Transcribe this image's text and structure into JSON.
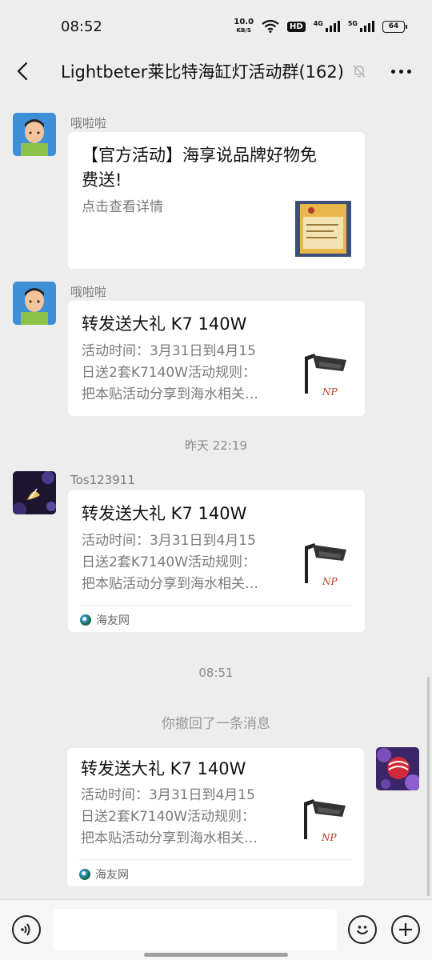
{
  "status_bar": {
    "time": "08:52",
    "net_speed": "10.0",
    "net_unit": "KB/S",
    "hd_label": "HD",
    "sim1_tag": "4G",
    "sim2_tag": "5G",
    "battery": "64"
  },
  "header": {
    "title": "Lightbeter莱比特海缸灯活动群(162)",
    "back_icon": "back-arrow-icon",
    "mute_icon": "bell-off-icon",
    "more_icon": "more-dots-icon"
  },
  "messages": [
    {
      "sender": "哦啦啦",
      "title": "【官方活动】海享说品牌好物免费送!",
      "title_lines": [
        "【官方活动】海享说品牌好物免",
        "费送!"
      ],
      "desc": "点击查看详情",
      "thumb": "product-box-thumbnail"
    },
    {
      "sender": "哦啦啦",
      "title": "转发送大礼 K7 140W",
      "desc": "活动时间：3月31日到4月15\n日送2套K7140W活动规则：\n把本贴活动分享到海水相关…",
      "thumb": "aquarium-light-thumbnail"
    },
    {
      "timestamp": "昨天 22:19"
    },
    {
      "sender": "Tos123911",
      "title": "转发送大礼 K7 140W",
      "desc": "活动时间：3月31日到4月15\n日送2套K7140W活动规则：\n把本贴活动分享到海水相关…",
      "source": "海友网"
    },
    {
      "timestamp": "08:51"
    },
    {
      "recall_notice": "你撤回了一条消息"
    },
    {
      "title": "转发送大礼 K7 140W",
      "desc": "活动时间：3月31日到4月15\n日送2套K7140W活动规则：\n把本贴活动分享到海水相关…",
      "source": "海友网"
    }
  ],
  "input_bar": {
    "voice_icon": "voice-icon",
    "text_value": "",
    "emoji_icon": "emoji-icon",
    "plus_icon": "plus-icon"
  },
  "colors": {
    "background": "#ededed",
    "card": "#ffffff",
    "meta_text": "#7d7d7d"
  }
}
